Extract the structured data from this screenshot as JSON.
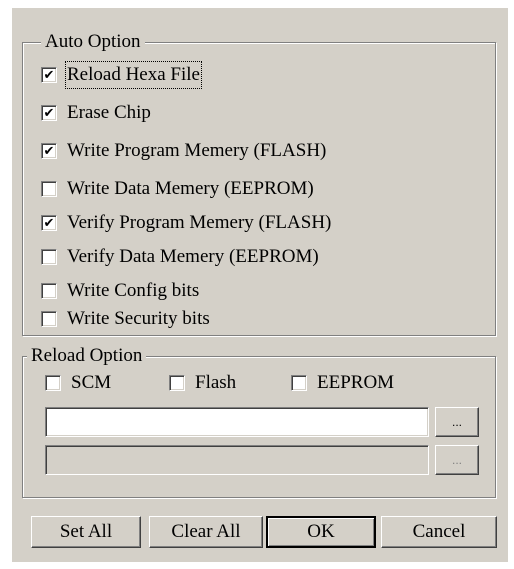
{
  "auto_option": {
    "legend": "Auto Option",
    "items": [
      {
        "label": "Reload Hexa File",
        "checked": true
      },
      {
        "label": "Erase Chip",
        "checked": true
      },
      {
        "label": "Write Program Memery (FLASH)",
        "checked": true
      },
      {
        "label": "Write Data Memery (EEPROM)",
        "checked": false
      },
      {
        "label": "Verify Program Memery (FLASH)",
        "checked": true
      },
      {
        "label": "Verify Data Memery (EEPROM)",
        "checked": false
      },
      {
        "label": "Write Config bits",
        "checked": false
      },
      {
        "label": "Write Security bits",
        "checked": false
      }
    ]
  },
  "reload_option": {
    "legend": "Reload Option",
    "scm": {
      "label": "SCM",
      "checked": false
    },
    "flash": {
      "label": "Flash",
      "checked": false
    },
    "eeprom": {
      "label": "EEPROM",
      "checked": false
    },
    "path1": {
      "value": ""
    },
    "path2": {
      "value": ""
    },
    "browse1_label": "...",
    "browse2_label": "..."
  },
  "buttons": {
    "set_all": "Set All",
    "clear_all": "Clear All",
    "ok": "OK",
    "cancel": "Cancel"
  },
  "check_glyph": "✔"
}
